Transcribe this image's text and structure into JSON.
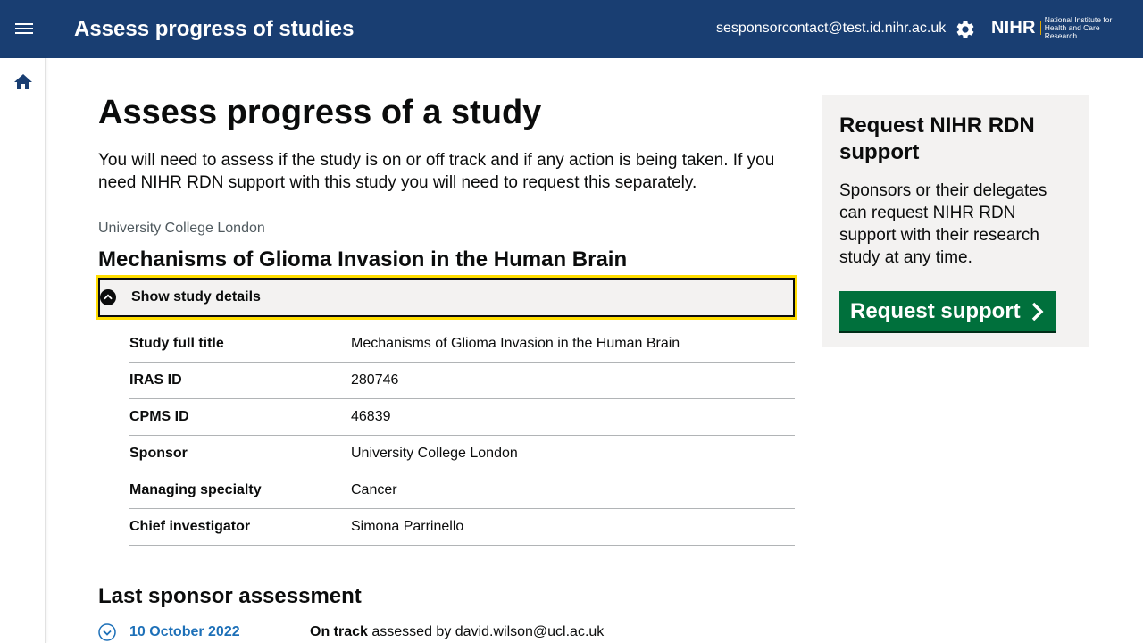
{
  "header": {
    "title": "Assess progress of studies",
    "user_email": "sesponsorcontact@test.id.nihr.ac.uk",
    "logo_main": "NIHR",
    "logo_sub": "National Institute for Health and Care Research",
    "bg_color": "#193e72"
  },
  "sidebar": {
    "home_icon": "home-icon"
  },
  "main": {
    "title": "Assess progress of a study",
    "intro": "You will need to assess if the study is on or off track and if any action is being taken. If you need NIHR RDN support with this study you will need to request this separately.",
    "organisation": "University College London",
    "study_title": "Mechanisms of Glioma Invasion in the Human Brain",
    "toggle_label": "Show study details",
    "details": [
      {
        "key": "Study full title",
        "value": "Mechanisms of Glioma Invasion in the Human Brain"
      },
      {
        "key": "IRAS ID",
        "value": "280746"
      },
      {
        "key": "CPMS ID",
        "value": "46839"
      },
      {
        "key": "Sponsor",
        "value": "University College London"
      },
      {
        "key": "Managing specialty",
        "value": "Cancer"
      },
      {
        "key": "Chief investigator",
        "value": "Simona Parrinello"
      }
    ],
    "assessment_heading": "Last sponsor assessment",
    "assessment": {
      "date": "10 October 2022",
      "status": "On track",
      "by_text": "assessed by david.wilson@ucl.ac.uk"
    }
  },
  "aside": {
    "title": "Request NIHR RDN support",
    "text": "Sponsors or their delegates can request NIHR RDN support with their research study at any time.",
    "button_label": "Request support",
    "button_color": "#00703c"
  }
}
